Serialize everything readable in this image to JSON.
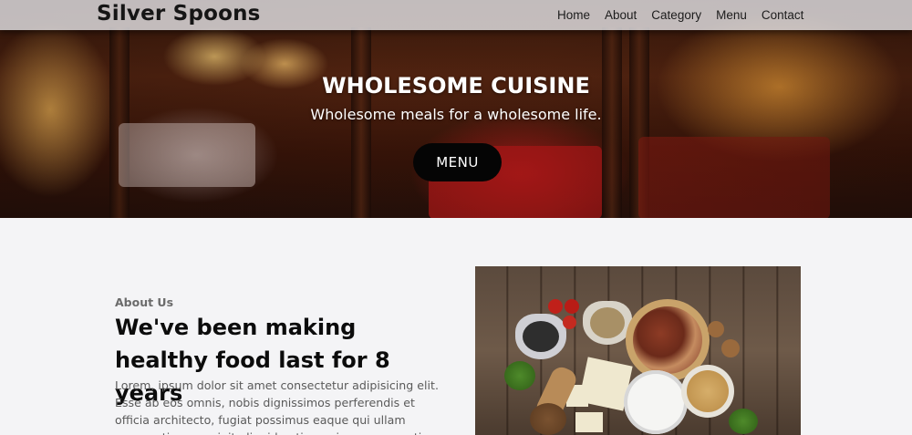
{
  "brand": "Silver Spoons",
  "nav": {
    "items": [
      "Home",
      "About",
      "Category",
      "Menu",
      "Contact"
    ]
  },
  "hero": {
    "title": "WHOLESOME CUISINE",
    "subtitle": "Wholesome meals for a wholesome life.",
    "button_label": "MENU"
  },
  "about": {
    "eyebrow": "About Us",
    "heading": "We've been making healthy food last for 8 years",
    "body": "Lorem, ipsum dolor sit amet consectetur adipisicing elit. Esse ab eos omnis, nobis dignissimos perferendis et officia architecto, fugiat possimus eaque qui ullam accusantium suscipit aliquid optio, maiores praesentium."
  },
  "colors": {
    "nav_bg": "#ebebee",
    "button_bg": "#050505",
    "page_bg": "#f4f4f6",
    "heading": "#0c0c0c"
  }
}
